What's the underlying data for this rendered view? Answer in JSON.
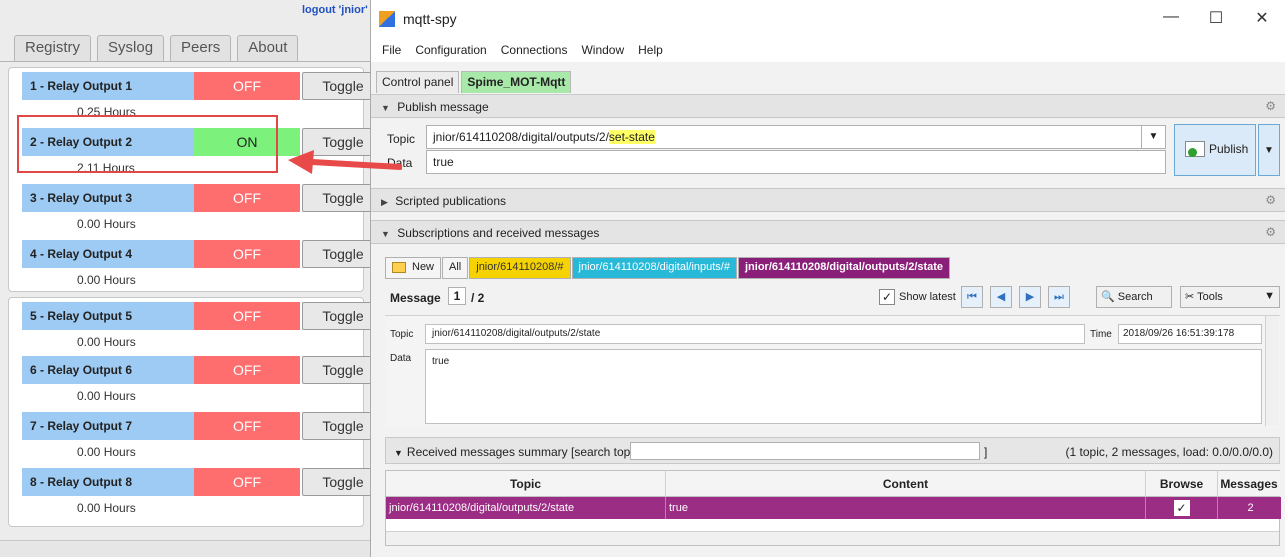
{
  "left": {
    "logout": "logout 'jnior'",
    "tabs": [
      "Registry",
      "Syslog",
      "Peers",
      "About"
    ],
    "relays": [
      {
        "name": "1 - Relay Output 1",
        "state": "OFF",
        "toggle": "Toggle",
        "hours": "0.25 Hours"
      },
      {
        "name": "2 - Relay Output 2",
        "state": "ON",
        "toggle": "Toggle",
        "hours": "2.11 Hours"
      },
      {
        "name": "3 - Relay Output 3",
        "state": "OFF",
        "toggle": "Toggle",
        "hours": "0.00 Hours"
      },
      {
        "name": "4 - Relay Output 4",
        "state": "OFF",
        "toggle": "Toggle",
        "hours": "0.00 Hours"
      },
      {
        "name": "5 - Relay Output 5",
        "state": "OFF",
        "toggle": "Toggle",
        "hours": "0.00 Hours"
      },
      {
        "name": "6 - Relay Output 6",
        "state": "OFF",
        "toggle": "Toggle",
        "hours": "0.00 Hours"
      },
      {
        "name": "7 - Relay Output 7",
        "state": "OFF",
        "toggle": "Toggle",
        "hours": "0.00 Hours"
      },
      {
        "name": "8 - Relay Output 8",
        "state": "OFF",
        "toggle": "Toggle",
        "hours": "0.00 Hours"
      }
    ]
  },
  "window": {
    "title": "mqtt-spy",
    "controls": {
      "minimize": "—",
      "maximize": "☐",
      "close": "✕"
    }
  },
  "menu": [
    "File",
    "Configuration",
    "Connections",
    "Window",
    "Help"
  ],
  "tabs": [
    "Control panel",
    "Spime_MOT-Mqtt"
  ],
  "publish": {
    "header": "Publish message",
    "topic_label": "Topic",
    "data_label": "Data",
    "topic_prefix": "jnior/614110208/digital/outputs/2/",
    "topic_highlight": "set-state",
    "data": "true",
    "button": "Publish"
  },
  "scripted": {
    "header": "Scripted publications"
  },
  "subscriptions": {
    "header": "Subscriptions and received messages",
    "tabs": [
      "New",
      "All",
      "jnior/614110208/#",
      "jnior/614110208/digital/inputs/#",
      "jnior/614110208/digital/outputs/2/state"
    ],
    "message_label": "Message",
    "message_index": "1",
    "message_total": "/ 2",
    "show_latest": "Show latest",
    "search": "Search",
    "tools": "Tools",
    "detail": {
      "topic_label": "Topic",
      "topic": "jnior/614110208/digital/outputs/2/state",
      "time_label": "Time",
      "time": "2018/09/26 16:51:39:178",
      "data_label": "Data",
      "data": "true"
    }
  },
  "summary": {
    "title": "Received messages summary [search topics:",
    "bracket": "]",
    "stats": "(1 topic, 2 messages, load: 0.0/0.0/0.0)",
    "columns": [
      "Topic",
      "Content",
      "Browse",
      "Messages"
    ],
    "rows": [
      {
        "topic": "jnior/614110208/digital/outputs/2/state",
        "content": "true",
        "browse": "✓",
        "messages": "2"
      }
    ]
  }
}
